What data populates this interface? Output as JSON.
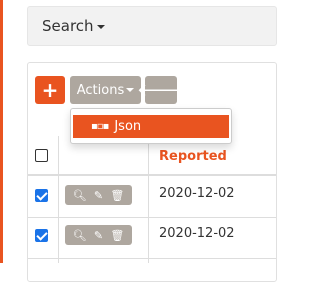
{
  "search": {
    "label": "Search"
  },
  "toolbar": {
    "add_label": "+",
    "actions_label": "Actions",
    "back_label": "🡐"
  },
  "actions_menu": {
    "items": [
      {
        "label": "Json",
        "icon": "json-grid-icon"
      }
    ]
  },
  "table": {
    "columns": [
      "",
      "",
      "Reported"
    ],
    "rows": [
      {
        "checked": true,
        "reported": "2020-12-02"
      },
      {
        "checked": true,
        "reported": "2020-12-02"
      }
    ]
  },
  "colors": {
    "accent": "#e95420",
    "secondary": "#aea79f",
    "checkbox": "#1a73e8"
  }
}
